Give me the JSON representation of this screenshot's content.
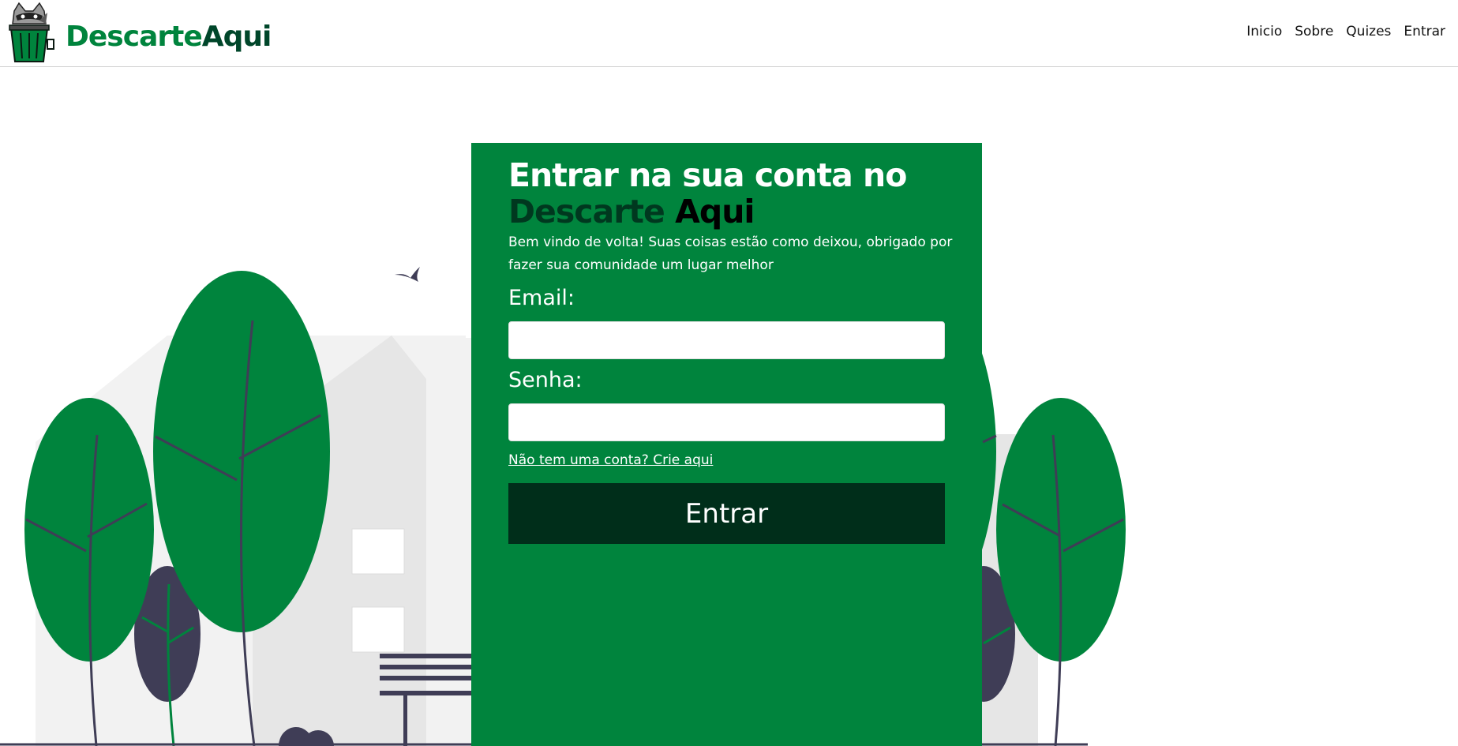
{
  "header": {
    "brand_part1": "Descarte",
    "brand_part2": "Aqui",
    "logo_icon": "raccoon-trash-bin-icon",
    "nav": [
      "Inicio",
      "Sobre",
      "Quizes",
      "Entrar"
    ]
  },
  "login": {
    "title_line1": "Entrar na sua conta no",
    "title_word1": "Descarte",
    "title_word2": "Aqui",
    "subtitle": "Bem vindo de volta! Suas coisas estão como deixou, obrigado por fazer sua comunidade um lugar melhor",
    "email_label": "Email:",
    "password_label": "Senha:",
    "email_value": "",
    "password_value": "",
    "signup_link": "Não tem uma conta? Crie aqui",
    "submit_label": "Entrar"
  },
  "colors": {
    "primary_green": "#00843d",
    "dark_green": "#002e1a",
    "tree_trunk": "#3f3d56",
    "building_light": "#f2f2f2",
    "building_mid": "#e6e6e6"
  },
  "illustration": {
    "icons": [
      "tree-icon",
      "bird-icon",
      "house-icon",
      "bench-icon",
      "bush-icon"
    ]
  }
}
